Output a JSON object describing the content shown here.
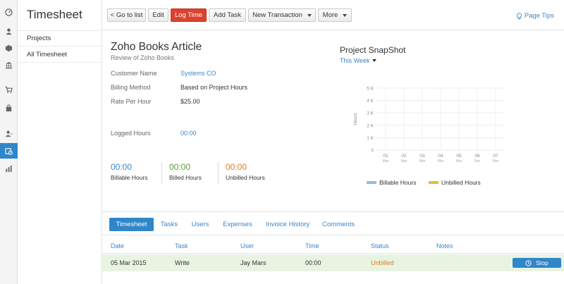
{
  "sidebar": {
    "title": "Timesheet",
    "items": [
      {
        "label": "Projects"
      },
      {
        "label": "All Timesheet"
      }
    ]
  },
  "iconbar": {
    "icons": [
      "dashboard-icon",
      "contacts-icon",
      "items-icon",
      "banking-icon",
      "sales-icon",
      "purchases-icon",
      "accountant-icon",
      "timesheet-icon",
      "reports-icon"
    ],
    "active_index": 7,
    "accent": "#2f86c9"
  },
  "toolbar": {
    "go_to_list": "< Go to list",
    "edit": "Edit",
    "log_time": "Log Time",
    "add_task": "Add Task",
    "new_transaction": "New Transaction",
    "more": "More",
    "page_tips": "Page Tips"
  },
  "project": {
    "title": "Zoho Books Article",
    "subtitle": "Review of Zoho Books",
    "fields": {
      "customer_label": "Customer Name",
      "customer_value": "Systems CO",
      "billing_label": "Billing Method",
      "billing_value": "Based on Project Hours",
      "rate_label": "Rate Per Hour",
      "rate_value": "$25.00",
      "logged_label": "Logged Hours",
      "logged_value": "00:00"
    },
    "hours": {
      "billable_value": "00:00",
      "billable_label": "Billable Hours",
      "billed_value": "00:00",
      "billed_label": "Billed Hours",
      "unbilled_value": "00:00",
      "unbilled_label": "Unbilled Hours"
    }
  },
  "snapshot": {
    "title": "Project SnapShot",
    "period": "This Week"
  },
  "chart_data": {
    "type": "bar",
    "ylabel": "Hours",
    "ylim": [
      0,
      5000
    ],
    "y_ticks": [
      "0",
      "1 K",
      "2 K",
      "3 K",
      "4 K",
      "5 K"
    ],
    "categories": [
      {
        "day": "01",
        "month": "Mar"
      },
      {
        "day": "02",
        "month": "Mar"
      },
      {
        "day": "03",
        "month": "Mar"
      },
      {
        "day": "04",
        "month": "Mar"
      },
      {
        "day": "05",
        "month": "Mar"
      },
      {
        "day": "06",
        "month": "Mar"
      },
      {
        "day": "07",
        "month": "Mar"
      }
    ],
    "series": [
      {
        "name": "Billable Hours",
        "color": "#8dc0e6",
        "values": [
          0,
          0,
          0,
          0,
          0,
          0,
          0
        ]
      },
      {
        "name": "Unbilled Hours",
        "color": "#efb542",
        "values": [
          0,
          0,
          0,
          0,
          0,
          0,
          0
        ]
      }
    ],
    "grid": true,
    "legend": "bottom"
  },
  "tabs": [
    {
      "label": "Timesheet",
      "active": true
    },
    {
      "label": "Tasks",
      "active": false
    },
    {
      "label": "Users",
      "active": false
    },
    {
      "label": "Expenses",
      "active": false
    },
    {
      "label": "Invoice History",
      "active": false
    },
    {
      "label": "Comments",
      "active": false
    }
  ],
  "table": {
    "columns": [
      "Date",
      "Task",
      "User",
      "Time",
      "Status",
      "Notes"
    ],
    "rows": [
      {
        "date": "05 Mar 2015",
        "task": "Write",
        "user": "Jay Mars",
        "time": "00:00",
        "status": "Unbilled",
        "notes": "",
        "action": "Stop"
      }
    ]
  },
  "colors": {
    "link": "#3a86c8",
    "danger": "#d9432f",
    "unbilled": "#e07b21",
    "billed": "#5a9a3a",
    "row_highlight": "#e8f4e2"
  }
}
